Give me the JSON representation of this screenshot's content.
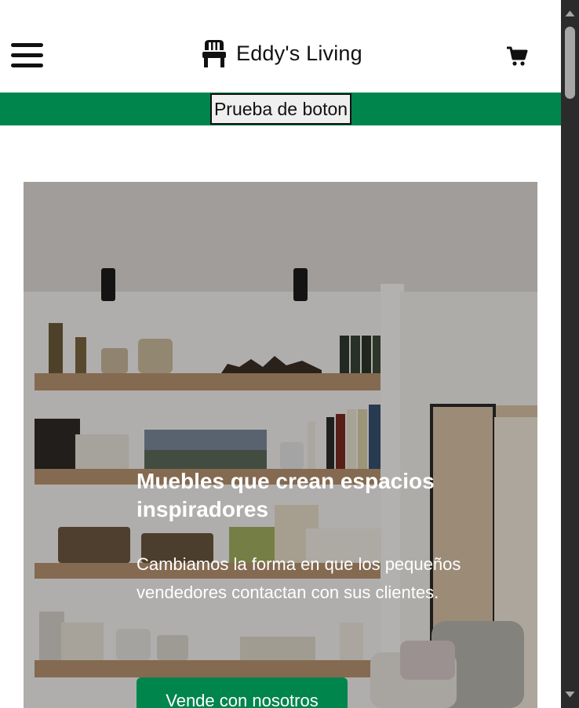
{
  "header": {
    "brand_name": "Eddy's Living",
    "icons": {
      "menu": "hamburger-menu-icon",
      "brand": "chair-icon",
      "cart": "shopping-cart-icon"
    }
  },
  "banner": {
    "button_label": "Prueba de boton"
  },
  "hero": {
    "title": "Muebles que crean espacios inspiradores",
    "description": "Cambiamos la forma en que los pequeños vendedores contactan con sus clientes.",
    "cta_label": "Vende con nosotros"
  },
  "colors": {
    "accent": "#00854d",
    "text": "#111111",
    "hero_text": "#ffffff"
  }
}
